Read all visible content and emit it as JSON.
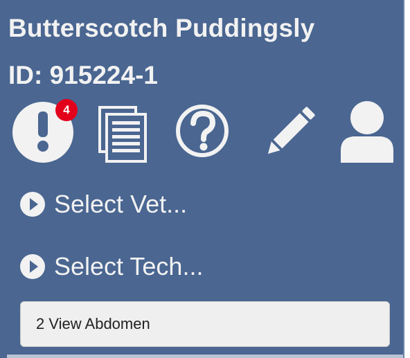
{
  "patient": {
    "name": "Butterscotch Puddingsly",
    "id_label": "ID: 915224-1"
  },
  "toolbar": {
    "alerts": {
      "icon": "exclamation-circle-icon",
      "badge_count": "4"
    },
    "documents": {
      "icon": "documents-icon"
    },
    "help": {
      "icon": "question-circle-icon"
    },
    "edit": {
      "icon": "pencil-icon"
    },
    "user": {
      "icon": "user-icon"
    }
  },
  "selectors": {
    "vet_label": "Select Vet...",
    "tech_label": "Select Tech..."
  },
  "procedure": {
    "value": "2 View Abdomen"
  },
  "colors": {
    "panel_bg": "#4a6691",
    "foreground": "#f2f2f2",
    "badge": "#e3001b",
    "field_bg": "#efefef"
  }
}
